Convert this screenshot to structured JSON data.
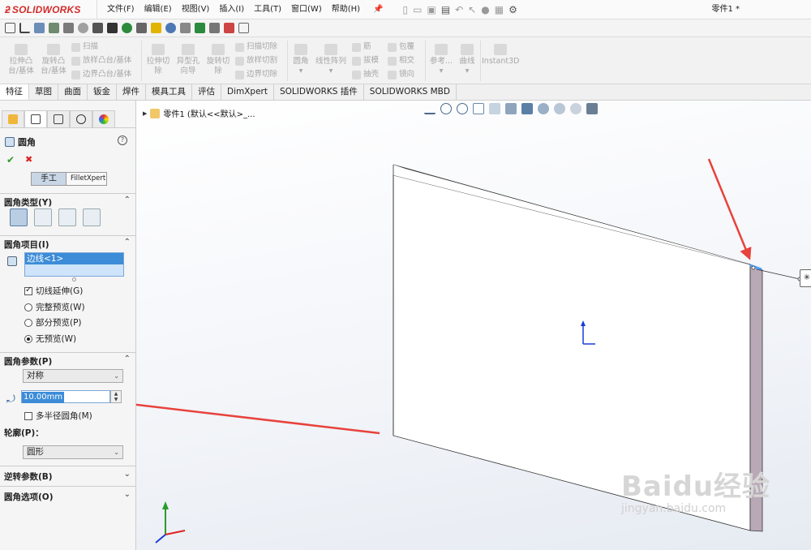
{
  "app": {
    "brand": "SOLIDWORKS",
    "menu": [
      "文件(F)",
      "编辑(E)",
      "视图(V)",
      "插入(I)",
      "工具(T)",
      "窗口(W)",
      "帮助(H)"
    ],
    "doc_title": "零件1 *"
  },
  "ribbon": {
    "extrude_boss": [
      "拉伸凸",
      "台/基体"
    ],
    "revolve_boss": [
      "旋转凸",
      "台/基体"
    ],
    "sweep": "扫描",
    "loft": "放样凸台/基体",
    "boundary": "边界凸台/基体",
    "extrude_cut": [
      "拉伸切",
      "除"
    ],
    "hole_wizard": [
      "异型孔",
      "向导"
    ],
    "revolve_cut": [
      "旋转切",
      "除"
    ],
    "swept_cut": "扫描切除",
    "lofted_cut": "放样切割",
    "boundary_cut": "边界切除",
    "fillet": "圆角",
    "linear_pattern": "线性阵列",
    "rib": "筋",
    "draft": "拔模",
    "shell": "抽壳",
    "wrap": "包覆",
    "intersect": "相交",
    "mirror": "镜向",
    "reference": "参考...",
    "curves": "曲线",
    "instant3d": "Instant3D"
  },
  "tabs": [
    "特征",
    "草图",
    "曲面",
    "钣金",
    "焊件",
    "模具工具",
    "评估",
    "DimXpert",
    "SOLIDWORKS 插件",
    "SOLIDWORKS MBD"
  ],
  "panel": {
    "title": "圆角",
    "help": "?",
    "mode_manual": "手工",
    "mode_xpert": "FilletXpert",
    "fillet_type": {
      "label": "圆角类型(Y)"
    },
    "fillet_items": {
      "label": "圆角项目(I)",
      "selected": "边线<1>",
      "tangent_propagation": "切线延伸(G)",
      "full_preview": "完整预览(W)",
      "partial_preview": "部分预览(P)",
      "no_preview": "无预览(W)"
    },
    "fillet_params": {
      "label": "圆角参数(P)",
      "method": "对称",
      "radius": "10.00mm",
      "multi_radius": "多半径圆角(M)",
      "profile_label": "轮廓(P)：",
      "profile": "圆形"
    },
    "setback": {
      "label": "逆转参数(B)"
    },
    "options": {
      "label": "圆角选项(O)"
    }
  },
  "canvas": {
    "tree_label": "零件1  (默认<<默认>_...",
    "watermark": "Baidu经验",
    "watermark_url": "jingyan.baidu.com",
    "callout_glyph": "✳"
  },
  "colors": {
    "arrow": "#e8423c",
    "selection": "#3c8cd8",
    "plate_side": "#b9a9b7",
    "accent": "#d42b2b"
  }
}
